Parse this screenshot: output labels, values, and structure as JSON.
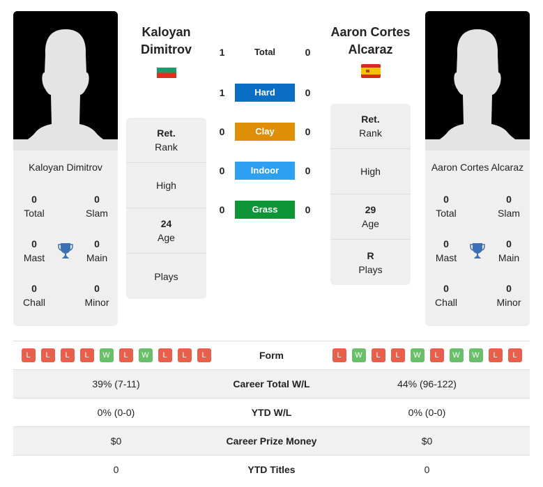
{
  "player1": {
    "name_line1": "Kaloyan",
    "name_line2": "Dimitrov",
    "full_name": "Kaloyan Dimitrov",
    "flag": "bulgaria-flag",
    "titles": {
      "total": "0",
      "total_label": "Total",
      "slam": "0",
      "slam_label": "Slam",
      "mast": "0",
      "mast_label": "Mast",
      "main": "0",
      "main_label": "Main",
      "chall": "0",
      "chall_label": "Chall",
      "minor": "0",
      "minor_label": "Minor"
    },
    "info": {
      "rank_value": "Ret.",
      "rank_label": "Rank",
      "high_value": "",
      "high_label": "High",
      "age_value": "24",
      "age_label": "Age",
      "plays_value": "",
      "plays_label": "Plays"
    },
    "form": [
      "L",
      "L",
      "L",
      "L",
      "W",
      "L",
      "W",
      "L",
      "L",
      "L"
    ],
    "career_wl": "39% (7-11)",
    "ytd_wl": "0% (0-0)",
    "prize": "$0",
    "ytd_titles": "0"
  },
  "player2": {
    "name_line1": "Aaron Cortes",
    "name_line2": "Alcaraz",
    "full_name": "Aaron Cortes Alcaraz",
    "flag": "spain-flag",
    "titles": {
      "total": "0",
      "total_label": "Total",
      "slam": "0",
      "slam_label": "Slam",
      "mast": "0",
      "mast_label": "Mast",
      "main": "0",
      "main_label": "Main",
      "chall": "0",
      "chall_label": "Chall",
      "minor": "0",
      "minor_label": "Minor"
    },
    "info": {
      "rank_value": "Ret.",
      "rank_label": "Rank",
      "high_value": "",
      "high_label": "High",
      "age_value": "29",
      "age_label": "Age",
      "plays_value": "R",
      "plays_label": "Plays"
    },
    "form": [
      "L",
      "W",
      "L",
      "L",
      "W",
      "L",
      "W",
      "W",
      "L",
      "L"
    ],
    "career_wl": "44% (96-122)",
    "ytd_wl": "0% (0-0)",
    "prize": "$0",
    "ytd_titles": "0"
  },
  "h2h": [
    {
      "label": "Total",
      "p1": "1",
      "p2": "0",
      "color": ""
    },
    {
      "label": "Hard",
      "p1": "1",
      "p2": "0",
      "color": "#0a6ec4"
    },
    {
      "label": "Clay",
      "p1": "0",
      "p2": "0",
      "color": "#df8e07"
    },
    {
      "label": "Indoor",
      "p1": "0",
      "p2": "0",
      "color": "#2f9ff2"
    },
    {
      "label": "Grass",
      "p1": "0",
      "p2": "0",
      "color": "#0e9538"
    }
  ],
  "stats_labels": {
    "form": "Form",
    "career_wl": "Career Total W/L",
    "ytd_wl": "YTD W/L",
    "prize": "Career Prize Money",
    "ytd_titles": "YTD Titles"
  },
  "colors": {
    "loss": "#e8604c",
    "win": "#6abf6a",
    "trophy": "#3b6fb6"
  }
}
